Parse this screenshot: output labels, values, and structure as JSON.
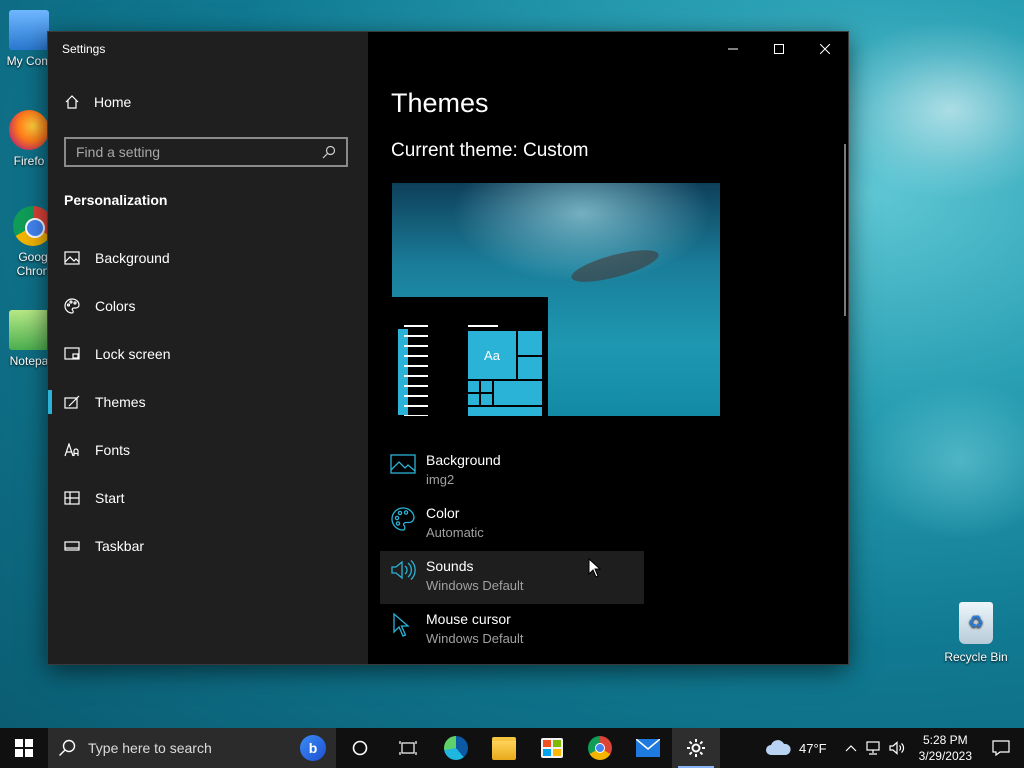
{
  "desktop": {
    "icons": [
      {
        "label": "My Com",
        "icon": "computer-icon"
      },
      {
        "label": "Firefo",
        "icon": "firefox-icon"
      },
      {
        "label": "Goog Chron",
        "icon": "chrome-icon"
      },
      {
        "label": "Notepa",
        "icon": "notepad-icon"
      }
    ],
    "recycle_bin": "Recycle Bin"
  },
  "window": {
    "title": "Settings",
    "controls": {
      "minimize": "minimize-icon",
      "maximize": "maximize-icon",
      "close": "close-icon"
    }
  },
  "sidebar": {
    "home_label": "Home",
    "search_placeholder": "Find a setting",
    "section_title": "Personalization",
    "items": [
      {
        "label": "Background",
        "icon": "image-icon",
        "active": false
      },
      {
        "label": "Colors",
        "icon": "palette-icon",
        "active": false
      },
      {
        "label": "Lock screen",
        "icon": "lock-screen-icon",
        "active": false
      },
      {
        "label": "Themes",
        "icon": "themes-icon",
        "active": true
      },
      {
        "label": "Fonts",
        "icon": "fonts-icon",
        "active": false
      },
      {
        "label": "Start",
        "icon": "start-icon",
        "active": false
      },
      {
        "label": "Taskbar",
        "icon": "taskbar-icon",
        "active": false
      }
    ],
    "accent_color": "#2ab3d6"
  },
  "main": {
    "title": "Themes",
    "current_theme": "Current theme: Custom",
    "preview_sample_text": "Aa",
    "settings": [
      {
        "name": "Background",
        "value": "img2",
        "icon": "image-icon"
      },
      {
        "name": "Color",
        "value": "Automatic",
        "icon": "palette-icon"
      },
      {
        "name": "Sounds",
        "value": "Windows Default",
        "icon": "speaker-icon"
      },
      {
        "name": "Mouse cursor",
        "value": "Windows Default",
        "icon": "mouse-cursor-icon"
      }
    ]
  },
  "taskbar": {
    "search_placeholder": "Type here to search",
    "apps": [
      "cortana-icon",
      "task-view-icon",
      "edge-icon",
      "file-explorer-icon",
      "store-icon",
      "chrome-icon",
      "mail-icon",
      "settings-icon"
    ],
    "weather": "47°F",
    "time": "5:28 PM",
    "date": "3/29/2023"
  }
}
